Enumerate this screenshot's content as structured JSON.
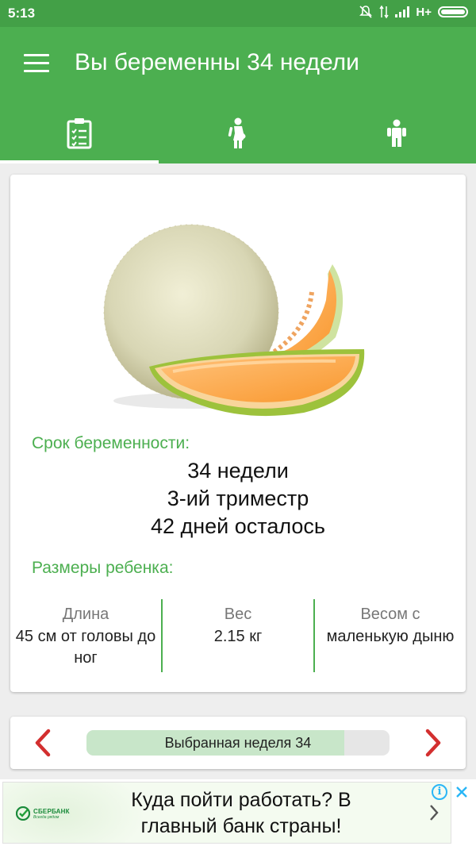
{
  "status_bar": {
    "time": "5:13",
    "network": "H+"
  },
  "header": {
    "title": "Вы беременны 34 недели"
  },
  "tabs": [
    {
      "icon": "clipboard-checklist-icon",
      "active": true
    },
    {
      "icon": "mother-icon",
      "active": false
    },
    {
      "icon": "child-icon",
      "active": false
    }
  ],
  "week_card": {
    "image": "melon-cantaloupe",
    "term_label": "Срок беременности:",
    "weeks_text": "34 недели",
    "trimester_text": "3-ий триместр",
    "days_left_text": "42 дней осталось",
    "sizes_label": "Размеры ребенка:",
    "length_header": "Длина",
    "length_value": "45 см от головы до ног",
    "weight_header": "Вес",
    "weight_value": "2.15 кг",
    "compare_header": "Весом с",
    "compare_value": "маленькую дыню"
  },
  "week_selector": {
    "label": "Выбранная неделя 34",
    "selected_week": 34,
    "progress_fraction": 0.85
  },
  "ad": {
    "brand": "СБЕРБАНК",
    "brand_tagline": "Всегда рядом",
    "text": "Куда пойти работать? В главный банк страны!"
  },
  "colors": {
    "status_bar": "#43a047",
    "primary": "#4caf50",
    "accent_arrow": "#d32f2f",
    "progress_fill": "#c8e6c9"
  }
}
